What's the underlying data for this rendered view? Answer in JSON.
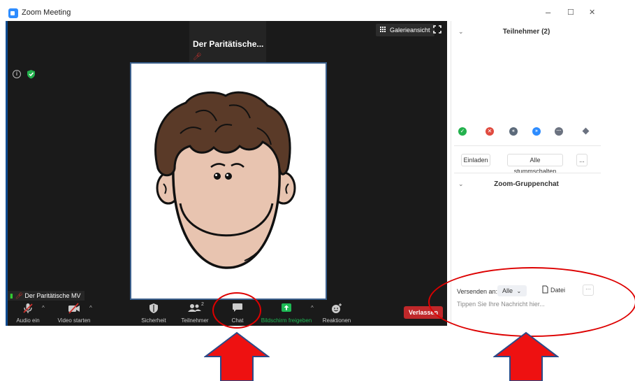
{
  "window": {
    "title": "Zoom Meeting",
    "controls": {
      "minimize": "–",
      "maximize": "☐",
      "close": "✕"
    }
  },
  "video": {
    "thumbnail_name": "Der Paritätische...",
    "gallery_view_label": "Galerieansicht",
    "name_label": "Der Paritätische MV"
  },
  "toolbar": {
    "audio_label": "Audio ein",
    "video_label": "Video starten",
    "security_label": "Sicherheit",
    "participants_label": "Teilnehmer",
    "participants_count": "2",
    "chat_label": "Chat",
    "share_label": "Bildschirm freigeben",
    "reactions_label": "Reaktionen",
    "leave_label": "Verlassen"
  },
  "panel": {
    "participants_title": "Teilnehmer (2)",
    "status_buttons": [
      "yes",
      "no",
      "slower",
      "faster",
      "more",
      "clear"
    ],
    "invite_label": "Einladen",
    "mute_all_label": "Alle stummschalten",
    "more_label": "...",
    "chat_title": "Zoom-Gruppenchat",
    "send_to_label": "Versenden an:",
    "send_to_value": "Alle",
    "file_label": "Datei",
    "chat_more_label": "···",
    "chat_placeholder": "Tippen Sie Ihre Nachricht hier..."
  },
  "colors": {
    "accent": "#2d8cff",
    "leave": "#c0282a",
    "share": "#1db954",
    "annotation": "#dd0000"
  }
}
